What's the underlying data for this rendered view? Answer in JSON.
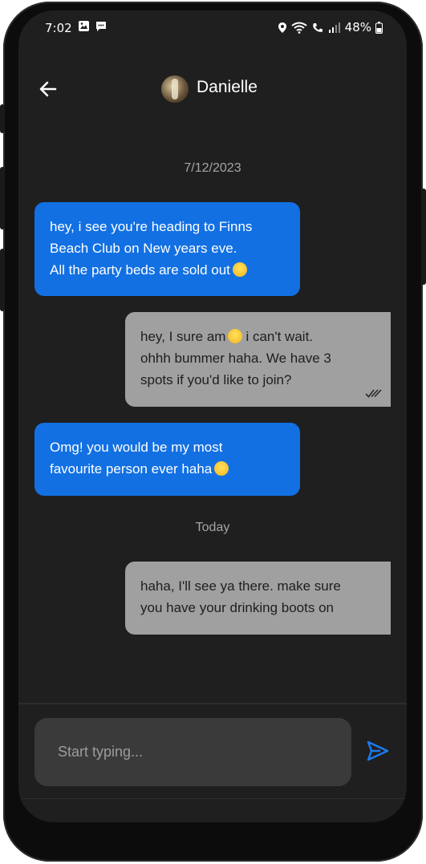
{
  "status_bar": {
    "time": "7:02",
    "battery": "48%"
  },
  "header": {
    "contact_name": "Danielle"
  },
  "messages": [
    {
      "type": "date",
      "text": "7/12/2023"
    },
    {
      "type": "incoming",
      "lines": [
        "hey, i see you're heading to Finns",
        "Beach Club on New years eve.",
        "All the party beds are sold out"
      ]
    },
    {
      "type": "outgoing",
      "lines": [
        "hey, I sure am",
        "i can't wait.",
        "ohhh bummer haha. We have 3",
        "spots if you'd like to join?"
      ]
    },
    {
      "type": "incoming",
      "lines": [
        "Omg! you would be my most",
        "favourite person ever haha"
      ]
    },
    {
      "type": "date",
      "text": "Today"
    },
    {
      "type": "outgoing",
      "lines": [
        "haha, I'll see ya there. make sure",
        "you have your drinking boots on"
      ]
    }
  ],
  "composer": {
    "placeholder": "Start typing..."
  },
  "colors": {
    "incoming_bubble": "#1270e3",
    "outgoing_bubble": "#a0a0a0",
    "background": "#1f1f1f",
    "send_icon": "#1b7cf0"
  },
  "icons": {
    "back": "arrow-left-icon",
    "send": "send-icon",
    "read_receipt": "double-check-icon"
  }
}
